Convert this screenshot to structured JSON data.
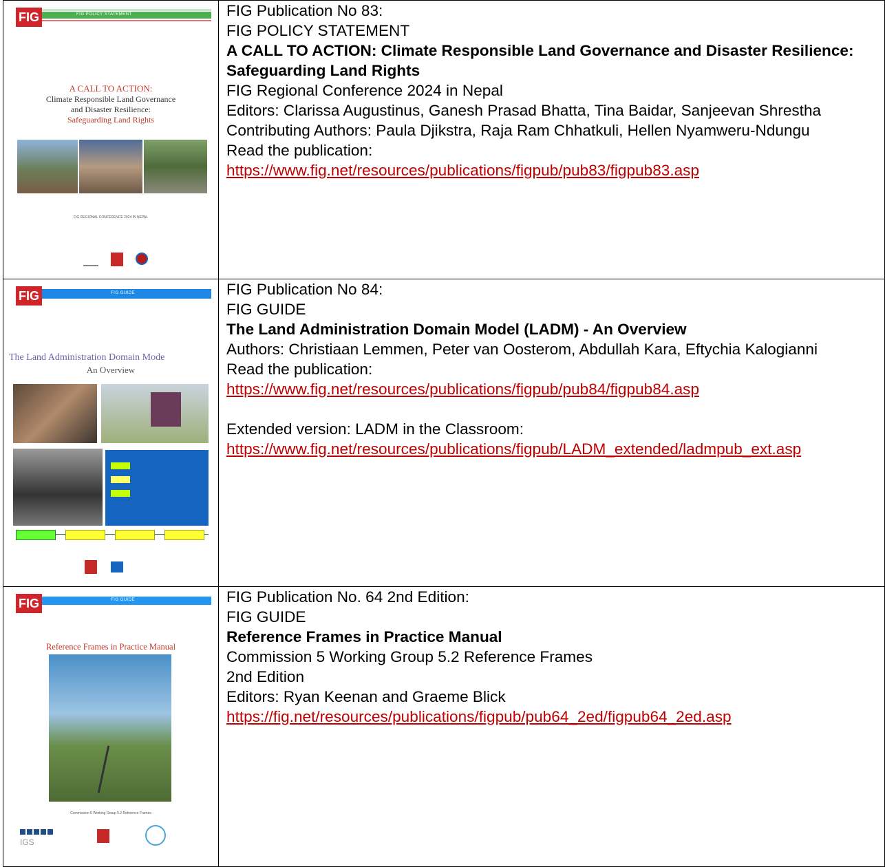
{
  "rows": [
    {
      "cover": {
        "logo": "FIG",
        "band_label": "FIG POLICY STATEMENT",
        "title_line1": "A CALL TO ACTION:",
        "title_line2": "Climate Responsible Land Governance",
        "title_line3": "and Disaster Resilience:",
        "title_line4": "Safeguarding Land Rights",
        "footer": "FIG REGIONAL CONFERENCE 2024 IN NEPAL"
      },
      "lines": {
        "pub_no": "FIG Publication No 83:",
        "type": "FIG POLICY STATEMENT",
        "title": "A CALL TO ACTION: Climate Responsible Land Governance and Disaster Resilience: Safeguarding Land Rights",
        "event": "FIG Regional Conference 2024 in Nepal",
        "editors": "Editors: Clarissa Augustinus, Ganesh Prasad Bhatta, Tina Baidar, Sanjeevan Shrestha",
        "contributors": "Contributing Authors: Paula Djikstra, Raja Ram Chhatkuli, Hellen Nyamweru-Ndungu",
        "read": "Read the publication:",
        "link": "https://www.fig.net/resources/publications/figpub/pub83/figpub83.asp"
      }
    },
    {
      "cover": {
        "logo": "FIG",
        "band_label": "FIG GUIDE",
        "title_line1": "The Land Administration Domain Mode",
        "title_line2": "An Overview"
      },
      "lines": {
        "pub_no": "FIG Publication No 84:",
        "type": "FIG GUIDE",
        "title": "The Land Administration Domain Model (LADM) - An Overview",
        "authors": "Authors: Christiaan Lemmen, Peter van Oosterom, Abdullah Kara, Eftychia Kalogianni",
        "read": "Read the publication:",
        "link": "https://www.fig.net/resources/publications/figpub/pub84/figpub84.asp",
        "extended": "Extended version: LADM in the Classroom:",
        "link2": "https://www.fig.net/resources/publications/figpub/LADM_extended/ladmpub_ext.asp"
      }
    },
    {
      "cover": {
        "logo": "FIG",
        "band_label": "FIG GUIDE",
        "title_line1": "Reference Frames in Practice Manual",
        "footer": "Commission 5 Working Group 5.2 Reference Frames",
        "igs": "IGS"
      },
      "lines": {
        "pub_no": "FIG Publication No. 64 2nd Edition:",
        "type": "FIG GUIDE",
        "title": "Reference Frames in Practice Manual",
        "commission": "Commission 5 Working Group 5.2 Reference Frames",
        "edition": "2nd Edition",
        "editors": "Editors: Ryan Keenan and Graeme Blick",
        "link": "https://fig.net/resources/publications/figpub/pub64_2ed/figpub64_2ed.asp"
      }
    }
  ]
}
